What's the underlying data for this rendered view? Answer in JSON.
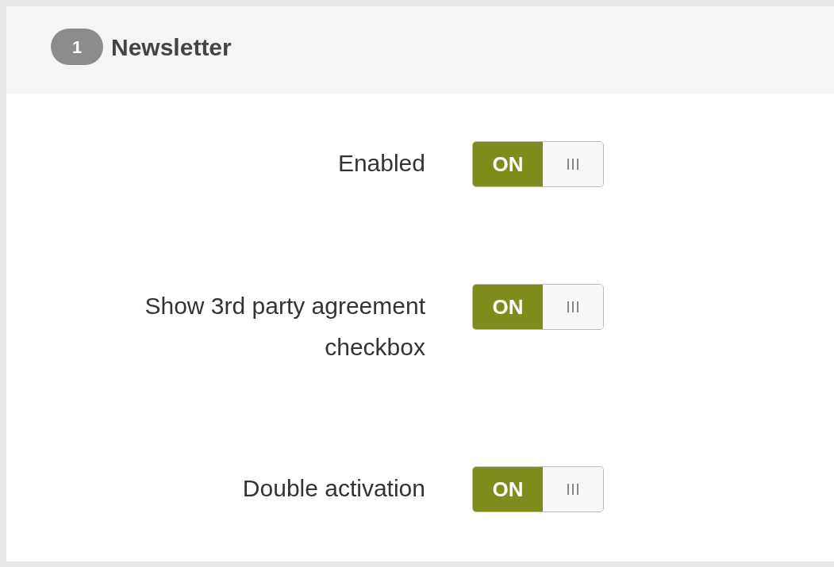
{
  "section": {
    "number": "1",
    "title": "Newsletter"
  },
  "settings": [
    {
      "label": "Enabled",
      "on": true,
      "state_text": "ON"
    },
    {
      "label": "Show 3rd party agreement checkbox",
      "on": true,
      "state_text": "ON"
    },
    {
      "label": "Double activation",
      "on": true,
      "state_text": "ON"
    }
  ]
}
